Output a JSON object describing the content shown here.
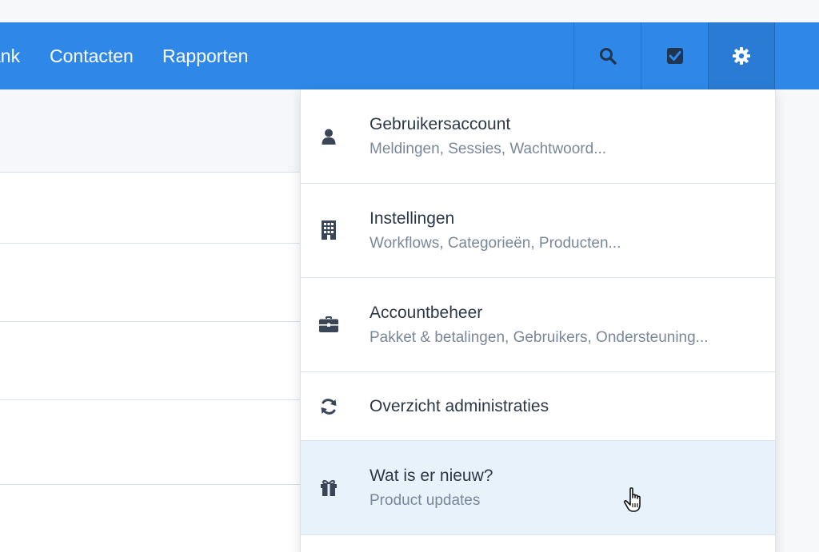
{
  "nav": {
    "links": [
      "ank",
      "Contacten",
      "Rapporten"
    ],
    "icons": [
      "search-icon",
      "tasks-checkbox-icon",
      "gear-icon"
    ]
  },
  "menu": {
    "items": [
      {
        "icon": "user-icon",
        "title": "Gebruikersaccount",
        "subtitle": "Meldingen, Sessies, Wachtwoord..."
      },
      {
        "icon": "building-icon",
        "title": "Instellingen",
        "subtitle": "Workflows, Categorieën, Producten..."
      },
      {
        "icon": "briefcase-icon",
        "title": "Accountbeheer",
        "subtitle": "Pakket & betalingen, Gebruikers, Ondersteuning..."
      },
      {
        "icon": "refresh-icon",
        "title": "Overzicht administraties"
      },
      {
        "icon": "gift-icon",
        "title": "Wat is er nieuw?",
        "subtitle": "Product updates"
      }
    ]
  },
  "colors": {
    "navbar": "#2f88e8",
    "navbar_active": "#2a7bd3",
    "hover_row": "#e8f2fb",
    "icon": "#3a4658"
  }
}
